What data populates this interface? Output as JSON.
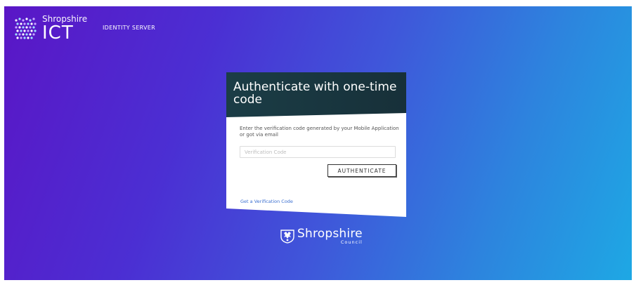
{
  "brand": {
    "small": "Shropshire",
    "big": "ICT",
    "subtitle": "IDENTITY SERVER"
  },
  "card": {
    "title": "Authenticate with one-time code",
    "description": "Enter the verification code generated by your Mobile Application or got via email",
    "input": {
      "placeholder": "Verification Code",
      "value": ""
    },
    "button_label": "AUTHENTICATE",
    "link_label": "Get a Verification Code"
  },
  "footer_logo": {
    "name": "Shropshire",
    "sub": "Council"
  },
  "colors": {
    "header_dark": "#183a43",
    "link": "#3b6fd0",
    "gradient_start": "#5a16c6",
    "gradient_end": "#1ea8e4"
  },
  "icons": [
    "shropshire-ict-logo-icon",
    "shropshire-council-crest-icon"
  ]
}
